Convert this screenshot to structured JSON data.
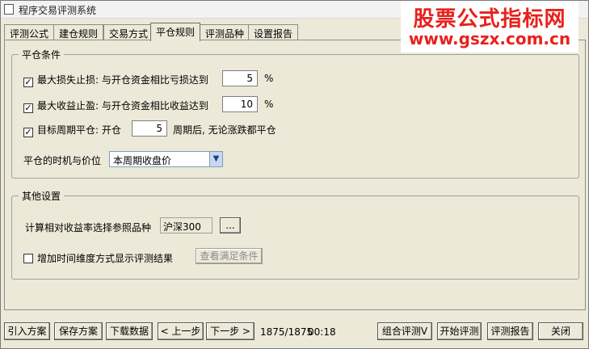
{
  "window": {
    "title": "程序交易评测系统"
  },
  "watermark": {
    "line1": "股票公式指标网",
    "line2": "www.gszx.com.cn"
  },
  "tabs": [
    {
      "label": "评测公式"
    },
    {
      "label": "建仓规则"
    },
    {
      "label": "交易方式"
    },
    {
      "label": "平仓规则",
      "active": true
    },
    {
      "label": "评测品种"
    },
    {
      "label": "设置报告"
    }
  ],
  "close_group": {
    "legend": "平仓条件",
    "stop_loss": {
      "checked": true,
      "label": "最大损失止损: 与开仓资金相比亏损达到",
      "value": "5",
      "unit": "%"
    },
    "take_profit": {
      "checked": true,
      "label": "最大收益止盈: 与开仓资金相比收益达到",
      "value": "10",
      "unit": "%"
    },
    "target_period": {
      "checked": true,
      "label": "目标周期平仓: 开仓",
      "value": "5",
      "suffix": "周期后, 无论涨跌都平仓"
    },
    "timing": {
      "label": "平仓的时机与价位",
      "selected": "本周期收盘价"
    }
  },
  "other_group": {
    "legend": "其他设置",
    "reference": {
      "label": "计算相对收益率选择参照品种",
      "value": "沪深300",
      "browse_label": "..."
    },
    "time_dimension": {
      "checked": false,
      "label": "增加时间维度方式显示评测结果"
    },
    "view_conditions_label": "查看满足条件"
  },
  "footer": {
    "import_label": "引入方案",
    "save_label": "保存方案",
    "download_label": "下载数据",
    "prev_label": "< 上一步",
    "next_label": "下一步 >",
    "progress": "1875/1875",
    "time": "00:18",
    "combo_label": "组合评测V",
    "start_label": "开始评测",
    "report_label": "评测报告",
    "close_label": "关闭"
  }
}
